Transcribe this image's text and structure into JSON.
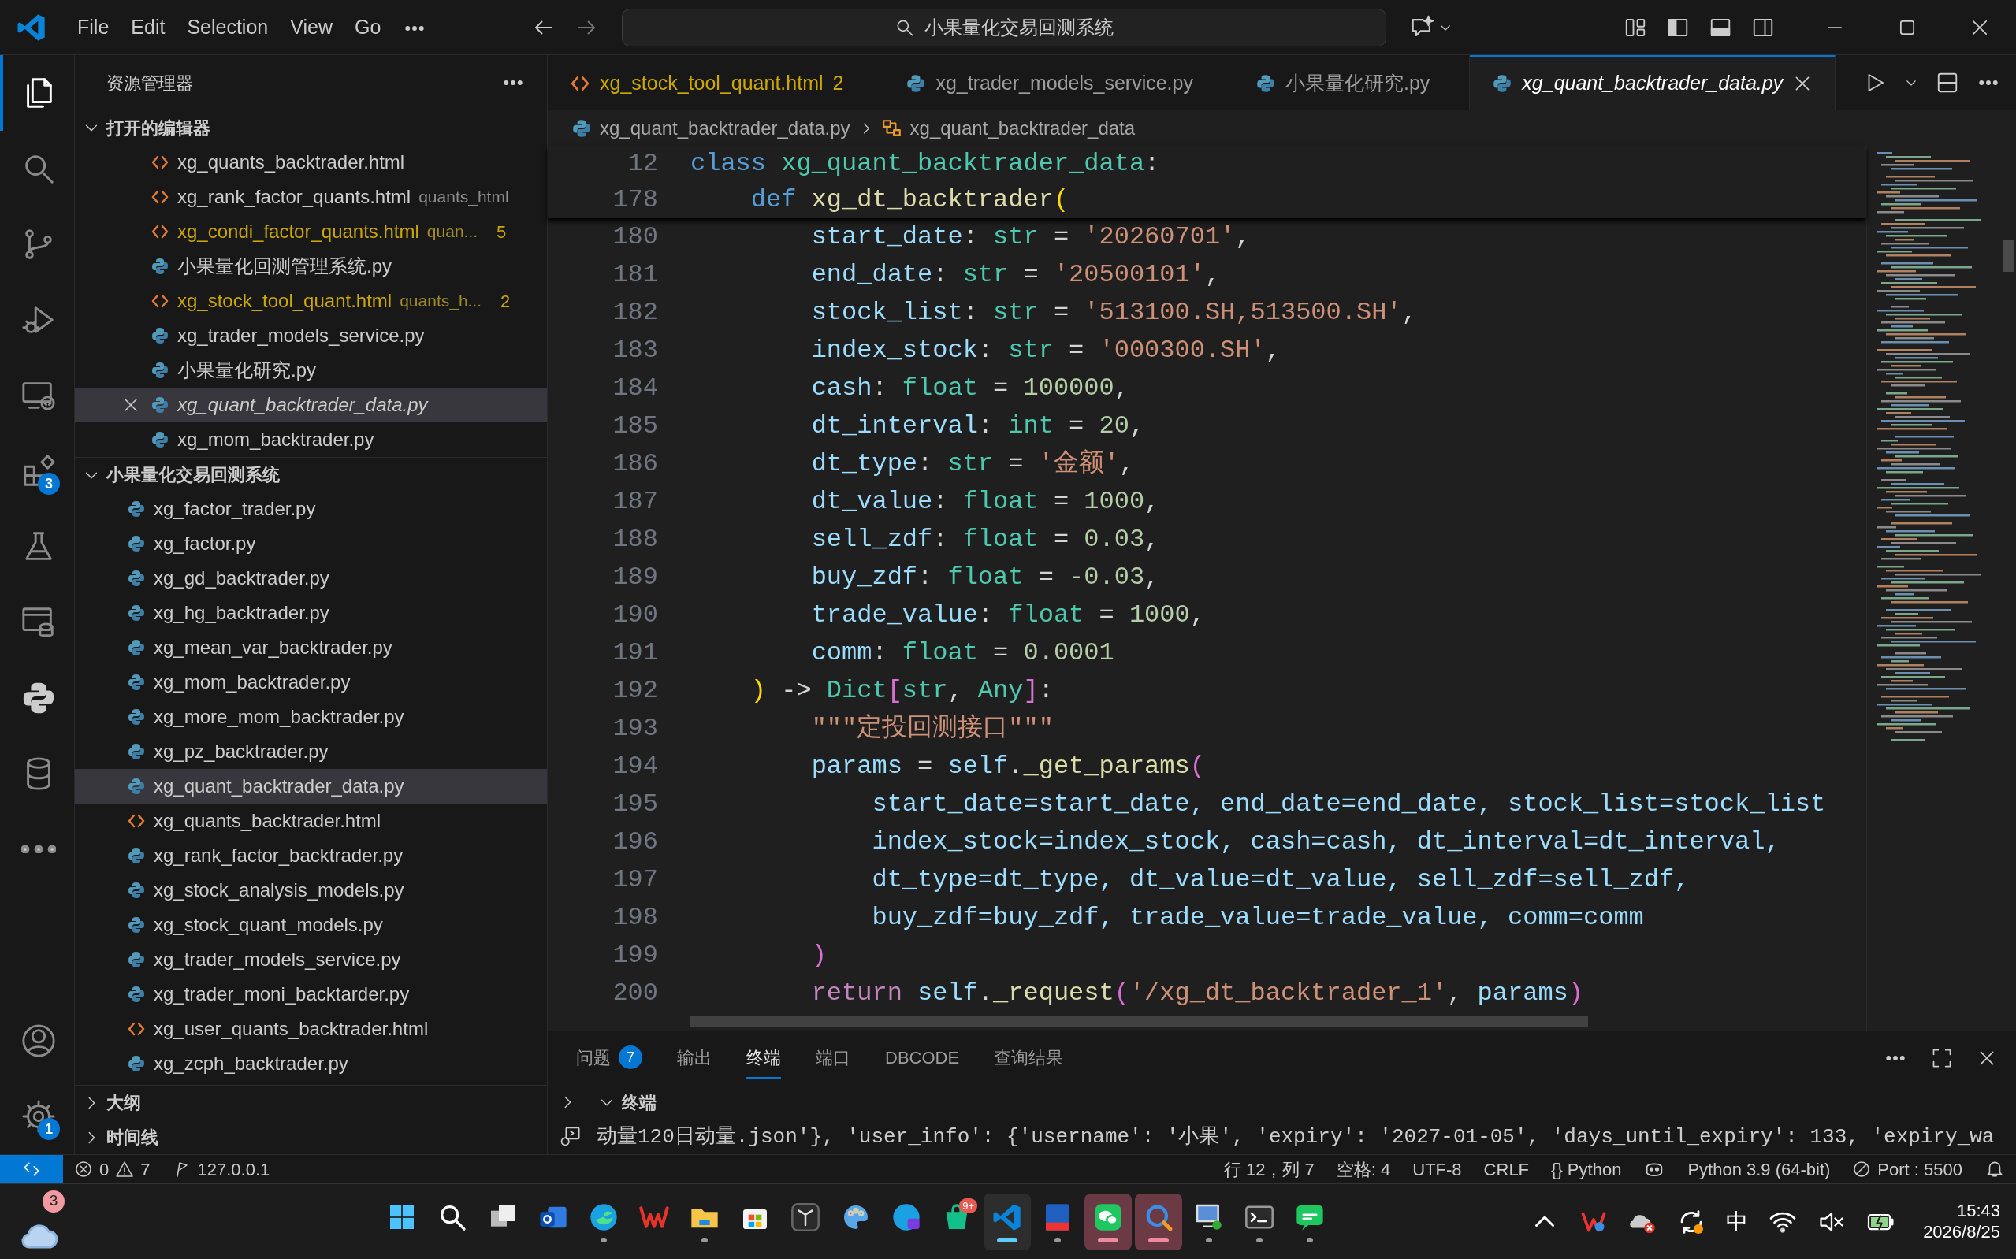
{
  "title_bar": {
    "menu": [
      "File",
      "Edit",
      "Selection",
      "View",
      "Go"
    ],
    "search": "小果量化交易回测系统"
  },
  "activity_bar": {
    "items": [
      {
        "kind": "files",
        "selected": true
      },
      {
        "kind": "search",
        "selected": false
      },
      {
        "kind": "scm",
        "selected": false
      },
      {
        "kind": "debug",
        "selected": false
      },
      {
        "kind": "remote",
        "selected": false
      },
      {
        "kind": "extensions",
        "selected": false,
        "badge": "3"
      },
      {
        "kind": "testing",
        "selected": false
      },
      {
        "kind": "dbwindow",
        "selected": false
      },
      {
        "kind": "python",
        "selected": false
      },
      {
        "kind": "database",
        "selected": false
      },
      {
        "kind": "more",
        "selected": false
      }
    ],
    "bottom": [
      {
        "kind": "account"
      },
      {
        "kind": "settings",
        "badge": "1"
      }
    ]
  },
  "sidebar": {
    "title": "资源管理器",
    "open_editors": {
      "label": "打开的编辑器",
      "expanded": true,
      "items": [
        {
          "kind": "html",
          "name": "xg_quants_backtrader.html",
          "warning": false,
          "selected": false,
          "preview": false
        },
        {
          "kind": "html",
          "name": "xg_rank_factor_quants.html",
          "description": "quants_html",
          "warning": false,
          "selected": false,
          "preview": false
        },
        {
          "kind": "html",
          "name": "xg_condi_factor_quants.html",
          "description": "quan...",
          "problems": "5",
          "warning": true,
          "selected": false,
          "preview": false
        },
        {
          "kind": "py",
          "name": "小果量化回测管理系统.py",
          "warning": false,
          "selected": false,
          "preview": false
        },
        {
          "kind": "html",
          "name": "xg_stock_tool_quant.html",
          "description": "quants_h...",
          "problems": "2",
          "warning": true,
          "selected": false,
          "preview": false
        },
        {
          "kind": "py",
          "name": "xg_trader_models_service.py",
          "warning": false,
          "selected": false,
          "preview": false
        },
        {
          "kind": "py",
          "name": "小果量化研究.py",
          "warning": false,
          "selected": false,
          "preview": false
        },
        {
          "kind": "py",
          "name": "xg_quant_backtrader_data.py",
          "warning": false,
          "selected": true,
          "preview": true
        },
        {
          "kind": "py",
          "name": "xg_mom_backtrader.py",
          "warning": false,
          "selected": false,
          "preview": false
        }
      ]
    },
    "folder": {
      "label": "小果量化交易回测系统",
      "expanded": true,
      "items": [
        {
          "kind": "py",
          "name": "xg_factor_trader.py",
          "selected": false
        },
        {
          "kind": "py",
          "name": "xg_factor.py",
          "selected": false
        },
        {
          "kind": "py",
          "name": "xg_gd_backtrader.py",
          "selected": false
        },
        {
          "kind": "py",
          "name": "xg_hg_backtrader.py",
          "selected": false
        },
        {
          "kind": "py",
          "name": "xg_mean_var_backtrader.py",
          "selected": false
        },
        {
          "kind": "py",
          "name": "xg_mom_backtrader.py",
          "selected": false
        },
        {
          "kind": "py",
          "name": "xg_more_mom_backtrader.py",
          "selected": false
        },
        {
          "kind": "py",
          "name": "xg_pz_backtrader.py",
          "selected": false
        },
        {
          "kind": "py",
          "name": "xg_quant_backtrader_data.py",
          "selected": true
        },
        {
          "kind": "html",
          "name": "xg_quants_backtrader.html",
          "selected": false
        },
        {
          "kind": "py",
          "name": "xg_rank_factor_backtrader.py",
          "selected": false
        },
        {
          "kind": "py",
          "name": "xg_stock_analysis_models.py",
          "selected": false
        },
        {
          "kind": "py",
          "name": "xg_stock_quant_models.py",
          "selected": false
        },
        {
          "kind": "py",
          "name": "xg_trader_models_service.py",
          "selected": false
        },
        {
          "kind": "py",
          "name": "xg_trader_moni_backtarder.py",
          "selected": false
        },
        {
          "kind": "html",
          "name": "xg_user_quants_backtrader.html",
          "selected": false
        },
        {
          "kind": "py",
          "name": "xg_zcph_backtrader.py",
          "selected": false
        }
      ]
    },
    "sections": [
      {
        "label": "大纲",
        "expanded": false
      },
      {
        "label": "时间线",
        "expanded": false
      }
    ]
  },
  "tabs": [
    {
      "kind": "html",
      "label": "xg_stock_tool_quant.html",
      "problems": "2",
      "warning": true,
      "selected": false,
      "preview": false
    },
    {
      "kind": "py",
      "label": "xg_trader_models_service.py",
      "warning": false,
      "selected": false,
      "preview": false
    },
    {
      "kind": "py",
      "label": "小果量化研究.py",
      "warning": false,
      "selected": false,
      "preview": false
    },
    {
      "kind": "py",
      "label": "xg_quant_backtrader_data.py",
      "warning": false,
      "selected": true,
      "preview": true
    }
  ],
  "breadcrumb": [
    {
      "kind": "py",
      "label": "xg_quant_backtrader_data.py"
    },
    {
      "kind": "class",
      "label": "xg_quant_backtrader_data"
    }
  ],
  "editor": {
    "sticky": [
      {
        "number": "12",
        "tokens": [
          {
            "text": "class ",
            "kind": "kw"
          },
          {
            "text": "xg_quant_backtrader_data",
            "kind": "cls"
          },
          {
            "text": ":",
            "kind": "op"
          }
        ]
      },
      {
        "number": "178",
        "tokens": [
          {
            "text": "    def ",
            "kind": "kw"
          },
          {
            "text": "xg_dt_backtrader",
            "kind": "fn"
          },
          {
            "text": "(",
            "kind": "br1"
          }
        ]
      }
    ],
    "lines": [
      {
        "number": "180",
        "tokens": [
          {
            "text": "        start_date",
            "kind": "param"
          },
          {
            "text": ": ",
            "kind": "op"
          },
          {
            "text": "str",
            "kind": "type"
          },
          {
            "text": " = ",
            "kind": "op"
          },
          {
            "text": "'20260701'",
            "kind": "str"
          },
          {
            "text": ",",
            "kind": "op"
          }
        ]
      },
      {
        "number": "181",
        "tokens": [
          {
            "text": "        end_date",
            "kind": "param"
          },
          {
            "text": ": ",
            "kind": "op"
          },
          {
            "text": "str",
            "kind": "type"
          },
          {
            "text": " = ",
            "kind": "op"
          },
          {
            "text": "'20500101'",
            "kind": "str"
          },
          {
            "text": ",",
            "kind": "op"
          }
        ]
      },
      {
        "number": "182",
        "tokens": [
          {
            "text": "        stock_list",
            "kind": "param"
          },
          {
            "text": ": ",
            "kind": "op"
          },
          {
            "text": "str",
            "kind": "type"
          },
          {
            "text": " = ",
            "kind": "op"
          },
          {
            "text": "'513100.SH,513500.SH'",
            "kind": "str"
          },
          {
            "text": ",",
            "kind": "op"
          }
        ]
      },
      {
        "number": "183",
        "tokens": [
          {
            "text": "        index_stock",
            "kind": "param"
          },
          {
            "text": ": ",
            "kind": "op"
          },
          {
            "text": "str",
            "kind": "type"
          },
          {
            "text": " = ",
            "kind": "op"
          },
          {
            "text": "'000300.SH'",
            "kind": "str"
          },
          {
            "text": ",",
            "kind": "op"
          }
        ]
      },
      {
        "number": "184",
        "tokens": [
          {
            "text": "        cash",
            "kind": "param"
          },
          {
            "text": ": ",
            "kind": "op"
          },
          {
            "text": "float",
            "kind": "type"
          },
          {
            "text": " = ",
            "kind": "op"
          },
          {
            "text": "100000",
            "kind": "num"
          },
          {
            "text": ",",
            "kind": "op"
          }
        ]
      },
      {
        "number": "185",
        "tokens": [
          {
            "text": "        dt_interval",
            "kind": "param"
          },
          {
            "text": ": ",
            "kind": "op"
          },
          {
            "text": "int",
            "kind": "type"
          },
          {
            "text": " = ",
            "kind": "op"
          },
          {
            "text": "20",
            "kind": "num"
          },
          {
            "text": ",",
            "kind": "op"
          }
        ]
      },
      {
        "number": "186",
        "tokens": [
          {
            "text": "        dt_type",
            "kind": "param"
          },
          {
            "text": ": ",
            "kind": "op"
          },
          {
            "text": "str",
            "kind": "type"
          },
          {
            "text": " = ",
            "kind": "op"
          },
          {
            "text": "'金额'",
            "kind": "str"
          },
          {
            "text": ",",
            "kind": "op"
          }
        ]
      },
      {
        "number": "187",
        "tokens": [
          {
            "text": "        dt_value",
            "kind": "param"
          },
          {
            "text": ": ",
            "kind": "op"
          },
          {
            "text": "float",
            "kind": "type"
          },
          {
            "text": " = ",
            "kind": "op"
          },
          {
            "text": "1000",
            "kind": "num"
          },
          {
            "text": ",",
            "kind": "op"
          }
        ]
      },
      {
        "number": "188",
        "tokens": [
          {
            "text": "        sell_zdf",
            "kind": "param"
          },
          {
            "text": ": ",
            "kind": "op"
          },
          {
            "text": "float",
            "kind": "type"
          },
          {
            "text": " = ",
            "kind": "op"
          },
          {
            "text": "0.03",
            "kind": "num"
          },
          {
            "text": ",",
            "kind": "op"
          }
        ]
      },
      {
        "number": "189",
        "tokens": [
          {
            "text": "        buy_zdf",
            "kind": "param"
          },
          {
            "text": ": ",
            "kind": "op"
          },
          {
            "text": "float",
            "kind": "type"
          },
          {
            "text": " = ",
            "kind": "op"
          },
          {
            "text": "-0.03",
            "kind": "num"
          },
          {
            "text": ",",
            "kind": "op"
          }
        ]
      },
      {
        "number": "190",
        "tokens": [
          {
            "text": "        trade_value",
            "kind": "param"
          },
          {
            "text": ": ",
            "kind": "op"
          },
          {
            "text": "float",
            "kind": "type"
          },
          {
            "text": " = ",
            "kind": "op"
          },
          {
            "text": "1000",
            "kind": "num"
          },
          {
            "text": ",",
            "kind": "op"
          }
        ]
      },
      {
        "number": "191",
        "tokens": [
          {
            "text": "        comm",
            "kind": "param"
          },
          {
            "text": ": ",
            "kind": "op"
          },
          {
            "text": "float",
            "kind": "type"
          },
          {
            "text": " = ",
            "kind": "op"
          },
          {
            "text": "0.0001",
            "kind": "num"
          }
        ]
      },
      {
        "number": "192",
        "tokens": [
          {
            "text": "    )",
            "kind": "br1"
          },
          {
            "text": " -> ",
            "kind": "op"
          },
          {
            "text": "Dict",
            "kind": "type"
          },
          {
            "text": "[",
            "kind": "br2"
          },
          {
            "text": "str",
            "kind": "type"
          },
          {
            "text": ", ",
            "kind": "op"
          },
          {
            "text": "Any",
            "kind": "type"
          },
          {
            "text": "]",
            "kind": "br2"
          },
          {
            "text": ":",
            "kind": "op"
          }
        ]
      },
      {
        "number": "193",
        "tokens": [
          {
            "text": "        \"\"\"定投回测接口\"\"\"",
            "kind": "str"
          }
        ]
      },
      {
        "number": "194",
        "tokens": [
          {
            "text": "        params",
            "kind": "param"
          },
          {
            "text": " = ",
            "kind": "op"
          },
          {
            "text": "self",
            "kind": "param"
          },
          {
            "text": ".",
            "kind": "op"
          },
          {
            "text": "_get_params",
            "kind": "fn"
          },
          {
            "text": "(",
            "kind": "br2"
          }
        ]
      },
      {
        "number": "195",
        "tokens": [
          {
            "text": "            start_date=start_date, end_date=end_date, stock_list=stock_list",
            "kind": "param"
          }
        ]
      },
      {
        "number": "196",
        "tokens": [
          {
            "text": "            index_stock=index_stock, cash=cash, dt_interval=dt_interval,",
            "kind": "param"
          }
        ]
      },
      {
        "number": "197",
        "tokens": [
          {
            "text": "            dt_type=dt_type, dt_value=dt_value, sell_zdf=sell_zdf,",
            "kind": "param"
          }
        ]
      },
      {
        "number": "198",
        "tokens": [
          {
            "text": "            buy_zdf=buy_zdf, trade_value=trade_value, comm=comm",
            "kind": "param"
          }
        ]
      },
      {
        "number": "199",
        "tokens": [
          {
            "text": "        )",
            "kind": "br2"
          }
        ]
      },
      {
        "number": "200",
        "tokens": [
          {
            "text": "        return ",
            "kind": "ctl"
          },
          {
            "text": "self",
            "kind": "param"
          },
          {
            "text": ".",
            "kind": "op"
          },
          {
            "text": "_request",
            "kind": "fn"
          },
          {
            "text": "(",
            "kind": "br2"
          },
          {
            "text": "'/xg_dt_backtrader_1'",
            "kind": "str"
          },
          {
            "text": ", ",
            "kind": "op"
          },
          {
            "text": "params",
            "kind": "param"
          },
          {
            "text": ")",
            "kind": "br2"
          }
        ]
      }
    ]
  },
  "panel": {
    "tabs": [
      {
        "label": "问题",
        "badge": "7",
        "selected": false
      },
      {
        "label": "输出",
        "selected": false
      },
      {
        "label": "终端",
        "selected": true
      },
      {
        "label": "端口",
        "selected": false
      },
      {
        "label": "DBCODE",
        "selected": false
      },
      {
        "label": "查询结果",
        "selected": false
      }
    ],
    "terminal": {
      "title": "终端",
      "expanded": true,
      "output": "动量120日动量.json'}, 'user_info': {'username': '小果', 'expiry': '2027-01-05', 'days_until_expiry': 133, 'expiry_wa"
    }
  },
  "status_bar": {
    "left": [
      {
        "kind": "remote"
      },
      {
        "kind": "problems",
        "errors": "0",
        "warnings": "7"
      },
      {
        "kind": "live",
        "label": "127.0.0.1"
      }
    ],
    "right": [
      {
        "kind": "text",
        "label": "行 12，列 7"
      },
      {
        "kind": "text",
        "label": "空格: 4"
      },
      {
        "kind": "text",
        "label": "UTF-8"
      },
      {
        "kind": "text",
        "label": "CRLF"
      },
      {
        "kind": "text",
        "label": "{} Python"
      },
      {
        "kind": "copilot"
      },
      {
        "kind": "text",
        "label": "Python 3.9 (64-bit)"
      },
      {
        "kind": "port",
        "label": "Port : 5500"
      },
      {
        "kind": "bell"
      }
    ]
  },
  "taskbar": {
    "weather_badge": "3",
    "apps": [
      {
        "kind": "start",
        "running": false,
        "selected": false,
        "flashing": false
      },
      {
        "kind": "search",
        "running": false,
        "selected": false,
        "flashing": false
      },
      {
        "kind": "taskview",
        "running": false,
        "selected": false,
        "flashing": false
      },
      {
        "kind": "mail",
        "running": false,
        "selected": false,
        "flashing": false
      },
      {
        "kind": "browser",
        "running": true,
        "selected": false,
        "flashing": false
      },
      {
        "kind": "wps",
        "running": false,
        "selected": false,
        "flashing": false
      },
      {
        "kind": "folder",
        "running": true,
        "selected": false,
        "flashing": false
      },
      {
        "kind": "store",
        "running": false,
        "selected": false,
        "flashing": false
      },
      {
        "kind": "darkapp",
        "running": false,
        "selected": false,
        "flashing": false
      },
      {
        "kind": "palette",
        "running": false,
        "selected": false,
        "flashing": false
      },
      {
        "kind": "browser2",
        "running": false,
        "selected": false,
        "flashing": false
      },
      {
        "kind": "bag",
        "badge": "9+",
        "running": false,
        "selected": false,
        "flashing": false
      },
      {
        "kind": "code",
        "running": true,
        "selected": true,
        "flashing": false
      },
      {
        "kind": "qmt",
        "running": true,
        "selected": false,
        "flashing": false
      },
      {
        "kind": "chat",
        "running": true,
        "selected": false,
        "flashing": true
      },
      {
        "kind": "searchapp",
        "running": true,
        "selected": false,
        "flashing": true
      },
      {
        "kind": "monitor",
        "running": true,
        "selected": false,
        "flashing": false
      },
      {
        "kind": "terminal",
        "running": true,
        "selected": false,
        "flashing": false
      },
      {
        "kind": "message",
        "running": true,
        "selected": false,
        "flashing": false
      }
    ],
    "tray": [
      {
        "kind": "chevron"
      },
      {
        "kind": "vivaldi"
      },
      {
        "kind": "cloudx"
      },
      {
        "kind": "sync"
      },
      {
        "kind": "ime",
        "label": "中"
      },
      {
        "kind": "wifi"
      },
      {
        "kind": "mute"
      },
      {
        "kind": "battery"
      }
    ],
    "time": "15:43",
    "date": "2026/8/25"
  }
}
